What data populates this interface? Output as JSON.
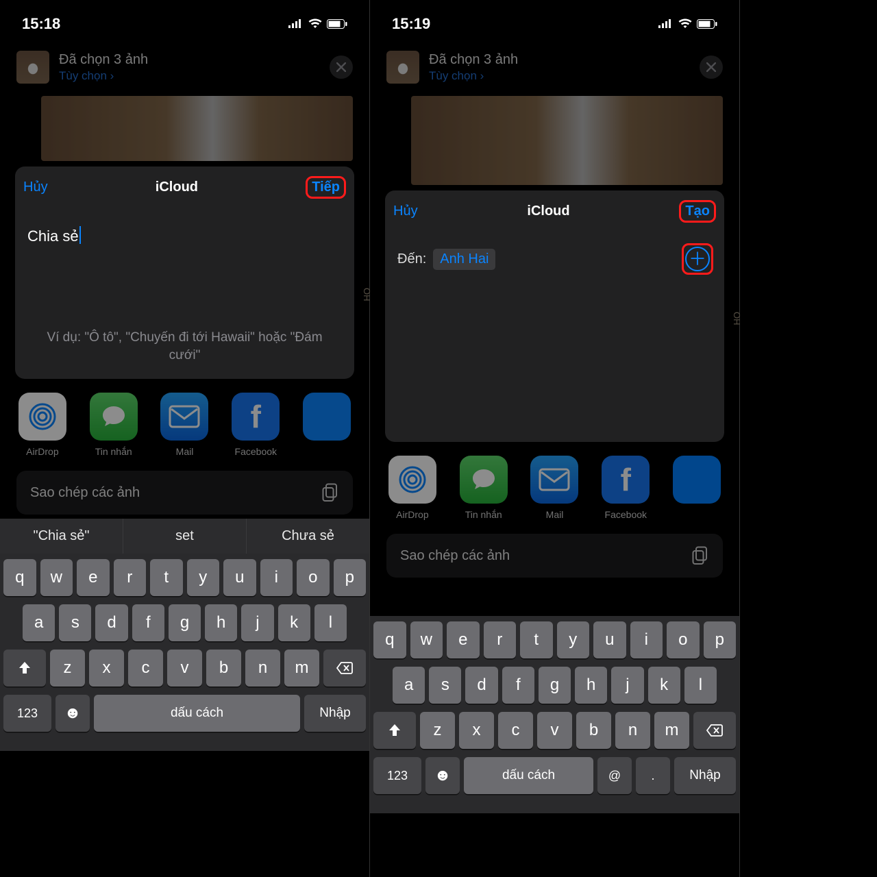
{
  "left": {
    "status": {
      "time": "15:18"
    },
    "header": {
      "title": "Đã chọn 3 ảnh",
      "options": "Tùy chọn ›"
    },
    "card": {
      "cancel": "Hủy",
      "title": "iCloud",
      "action": "Tiếp",
      "input_value": "Chia sẻ",
      "hint": "Ví dụ: \"Ô tô\", \"Chuyến đi tới Hawaii\" hoặc \"Đám cưới\""
    },
    "suggestions": [
      "\"Chia sẻ\"",
      "set",
      "Chưa sẻ"
    ],
    "space_label": "dấu cách",
    "enter_label": "Nhập"
  },
  "right": {
    "status": {
      "time": "15:19"
    },
    "header": {
      "title": "Đã chọn 3 ảnh",
      "options": "Tùy chọn ›"
    },
    "card": {
      "cancel": "Hủy",
      "title": "iCloud",
      "action": "Tạo",
      "to_label": "Đến:",
      "to_value": "Anh Hai"
    },
    "space_label": "dấu cách",
    "enter_label": "Nhập"
  },
  "apps": [
    {
      "name": "AirDrop"
    },
    {
      "name": "Tin nhắn"
    },
    {
      "name": "Mail"
    },
    {
      "name": "Facebook"
    }
  ],
  "copy_action": "Sao chép các ảnh",
  "keyboard": {
    "row1": [
      "q",
      "w",
      "e",
      "r",
      "t",
      "y",
      "u",
      "i",
      "o",
      "p"
    ],
    "row2": [
      "a",
      "s",
      "d",
      "f",
      "g",
      "h",
      "j",
      "k",
      "l"
    ],
    "row3": [
      "z",
      "x",
      "c",
      "v",
      "b",
      "n",
      "m"
    ],
    "numKey": "123"
  },
  "side_tag": "OH"
}
